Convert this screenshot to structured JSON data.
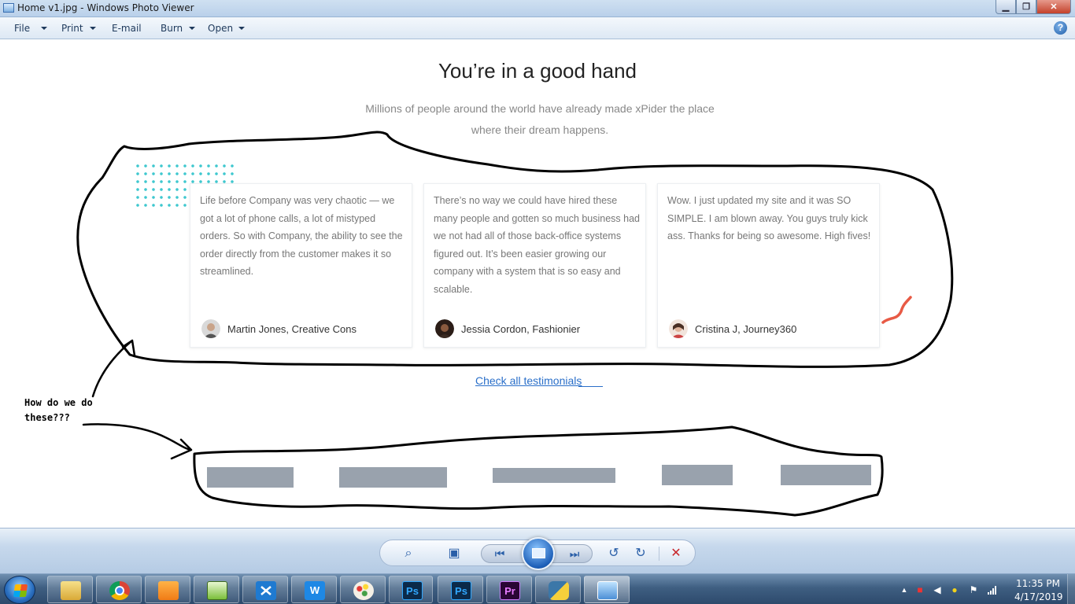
{
  "window": {
    "title": "Home v1.jpg - Windows Photo Viewer",
    "minimize_glyph": "▁",
    "maximize_glyph": "❐",
    "close_glyph": "✕"
  },
  "menu": {
    "file": "File",
    "print": "Print",
    "email": "E-mail",
    "burn": "Burn",
    "open": "Open",
    "help_glyph": "?"
  },
  "page": {
    "heading": "You’re in a good hand",
    "subtext": "Millions of people around the world have already made xPider the place where their dream happens.",
    "testimonials": [
      {
        "quote": "Life before Company was very chaotic — we got a lot of phone calls, a lot of mistyped orders. So with Company, the ability to see the order directly from the customer makes it so streamlined.",
        "author": "Martin Jones, Creative Cons"
      },
      {
        "quote": "There’s no way we could have hired these many people and gotten so much business had we not had all of those back-office systems figured out. It’s been easier growing our company with a system that is so easy and scalable.",
        "author": "Jessia Cordon, Fashionier"
      },
      {
        "quote": "Wow. I just updated my site and it was SO SIMPLE. I am blown away. You guys truly kick ass. Thanks for being so awesome. High fives!",
        "author": "Cristina J, Journey360"
      }
    ],
    "link": "Check all testimonials",
    "annotation": "How do we do these???"
  },
  "viewer": {
    "zoom_glyph": "⌕",
    "fit_glyph": "▣",
    "prev_glyph": "⏮",
    "next_glyph": "⏭",
    "rotate_left_glyph": "↺",
    "rotate_right_glyph": "↻",
    "delete_glyph": "✕"
  },
  "taskbar": {
    "time": "11:35 PM",
    "date": "4/17/2019",
    "apps": [
      "file-explorer",
      "chrome",
      "media-player",
      "notepad",
      "vscode",
      "writer",
      "paint",
      "photoshop",
      "photoshop",
      "premiere",
      "python",
      "photo-viewer"
    ],
    "ps_label": "Ps",
    "pr_label": "Pr",
    "w_label": "W"
  },
  "colors": {
    "accent_link": "#2a6fc9",
    "dots": "#3fc8cf",
    "squiggle": "#e85a45",
    "logo_placeholder": "#99a2ad"
  }
}
